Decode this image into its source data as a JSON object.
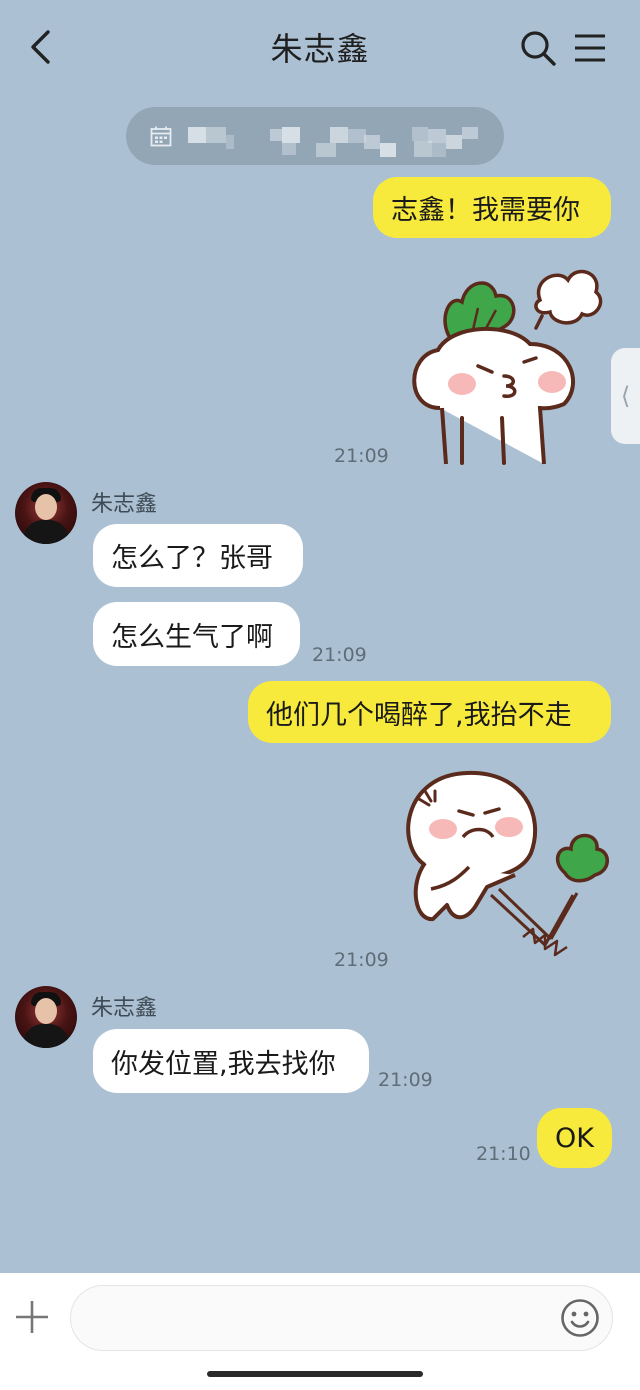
{
  "header": {
    "title": "朱志鑫",
    "back_icon": "chevron-left-icon",
    "search_icon": "search-icon",
    "menu_icon": "menu-icon"
  },
  "date_pill": {
    "icon": "calendar-icon"
  },
  "messages": [
    {
      "side": "me",
      "type": "text",
      "text": "志鑫！我需要你"
    },
    {
      "side": "me",
      "type": "sticker",
      "sticker": "radish-kiss-sticker",
      "time": "21:09"
    },
    {
      "side": "them",
      "sender": "朱志鑫",
      "type": "text",
      "text": "怎么了？张哥"
    },
    {
      "side": "them",
      "type": "text",
      "text": "怎么生气了啊",
      "time": "21:09"
    },
    {
      "side": "me",
      "type": "text",
      "text": "他们几个喝醉了,我抬不走"
    },
    {
      "side": "me",
      "type": "sticker",
      "sticker": "radish-pulling-sticker",
      "time": "21:09"
    },
    {
      "side": "them",
      "sender": "朱志鑫",
      "type": "text",
      "text": "你发位置,我去找你",
      "time": "21:09"
    },
    {
      "side": "me",
      "type": "text",
      "text": "OK",
      "time": "21:10"
    }
  ],
  "side_tab": {
    "glyph": "⟨"
  },
  "composer": {
    "plus_icon": "plus-icon",
    "emoji_icon": "emoji-icon",
    "placeholder": ""
  },
  "colors": {
    "background": "#abc1d3",
    "my_bubble": "#f7ea3c",
    "their_bubble": "#ffffff"
  }
}
